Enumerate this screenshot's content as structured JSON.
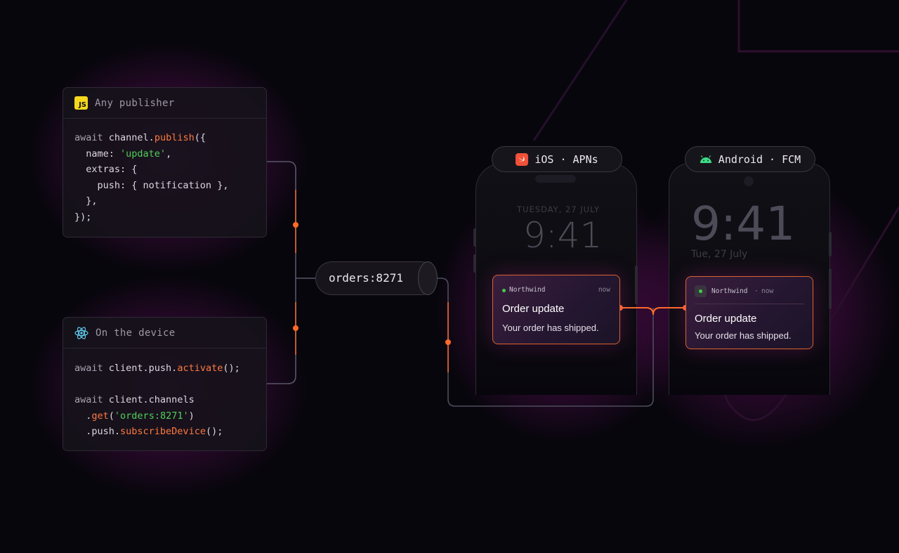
{
  "colors": {
    "background": "#07060c",
    "accent_orange": "#ff6a2a",
    "string_green": "#4fd05a",
    "glow_magenta": "#b0169e",
    "js_yellow": "#f4d81d",
    "swift_red": "#f05138",
    "android_green": "#3ddc84"
  },
  "publisher_card": {
    "icon": "js-icon",
    "badge_text": "JS",
    "title": "Any publisher",
    "code": {
      "l1_kw": "await ",
      "l1_obj": "channel.",
      "l1_fn": "publish",
      "l1_end": "({",
      "l2_key": "  name: ",
      "l2_str": "'update'",
      "l2_end": ",",
      "l3": "  extras: {",
      "l4": "    push: { notification },",
      "l5": "  },",
      "l6": "});"
    }
  },
  "device_card": {
    "icon": "react-icon",
    "title": "On the device",
    "code": {
      "l1_kw": "await ",
      "l1_obj": "client.push.",
      "l1_fn": "activate",
      "l1_end": "();",
      "l2_kw": "await ",
      "l2_obj": "client.channels",
      "l3_dot": "  .",
      "l3_fn": "get",
      "l3_open": "(",
      "l3_str": "'orders:8271'",
      "l3_close": ")",
      "l4_obj": "  .push.",
      "l4_fn": "subscribeDevice",
      "l4_end": "();"
    }
  },
  "channel": {
    "label": "orders:8271"
  },
  "ios": {
    "icon": "swift-icon",
    "platform_label": "iOS · APNs",
    "date": "TUESDAY, 27 JULY",
    "time": "9:41",
    "notification": {
      "app": "Northwind",
      "time": "now",
      "title": "Order update",
      "body": "Your order has shipped."
    }
  },
  "android": {
    "icon": "android-icon",
    "platform_label": "Android · FCM",
    "time": "9:41",
    "date": "Tue, 27 July",
    "notification": {
      "app": "Northwind",
      "separator": "·",
      "time": "now",
      "title": "Order update",
      "body": "Your order has shipped."
    }
  }
}
